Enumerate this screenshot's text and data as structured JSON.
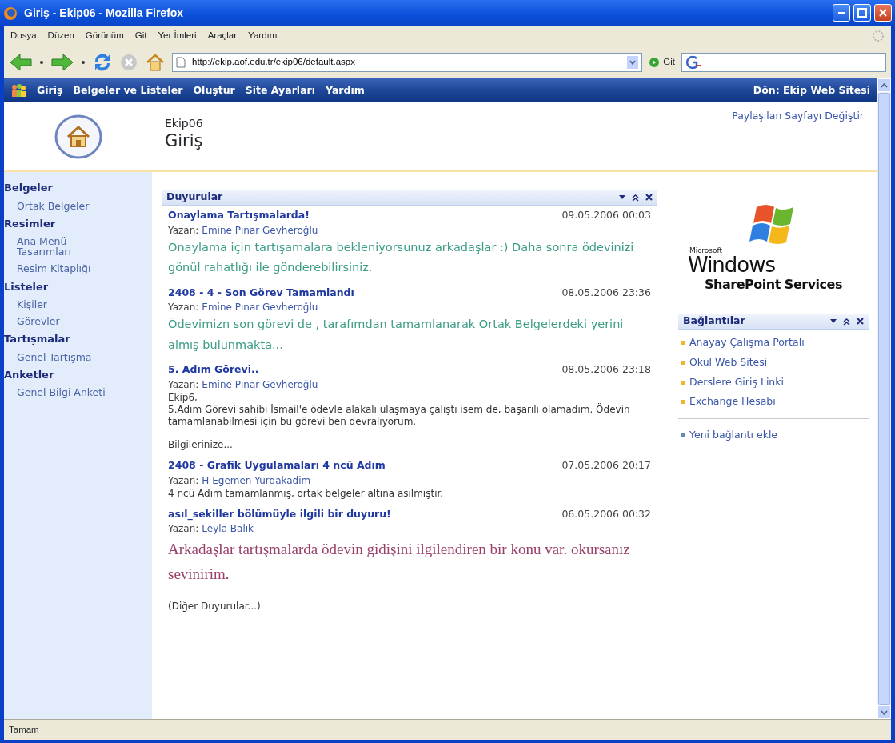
{
  "window": {
    "title": "Giriş - Ekip06  -  Mozilla Firefox"
  },
  "menu": [
    "Dosya",
    "Düzen",
    "Görünüm",
    "Git",
    "Yer İmleri",
    "Araçlar",
    "Yardım"
  ],
  "address": {
    "value": "http://ekip.aof.edu.tr/ekip06/default.aspx"
  },
  "go_button": "Git",
  "top_nav": {
    "items": [
      "Giriş",
      "Belgeler ve Listeler",
      "Oluştur",
      "Site Ayarları",
      "Yardım"
    ],
    "right_link": "Dön: Ekip Web Sitesi"
  },
  "header": {
    "site": "Ekip06",
    "page_title": "Giriş",
    "edit_link": "Paylaşılan Sayfayı Değiştir"
  },
  "sidebar": [
    {
      "label": "Belgeler",
      "children": [
        {
          "label": "Ortak Belgeler"
        }
      ]
    },
    {
      "label": "Resimler",
      "children": [
        {
          "label": "Ana Menü Tasarımları"
        },
        {
          "label": "Resim Kitaplığı"
        }
      ]
    },
    {
      "label": "Listeler",
      "children": [
        {
          "label": "Kişiler"
        },
        {
          "label": "Görevler"
        }
      ]
    },
    {
      "label": "Tartışmalar",
      "children": [
        {
          "label": "Genel Tartışma"
        }
      ]
    },
    {
      "label": "Anketler",
      "children": [
        {
          "label": "Genel Bilgi Anketi"
        }
      ]
    }
  ],
  "announcements": {
    "title": "Duyurular",
    "items": [
      {
        "title": "Onaylama Tartışmalarda!",
        "date": "09.05.2006 00:03",
        "by_label": "Yazan:",
        "author": "Emine Pınar Gevheroğlu",
        "kind": "colored",
        "color": "#3c9c86",
        "body": [
          "Onaylama için tartışamalara bekleniyorsunuz arkadaşlar :) Daha sonra ödevinizi gönül rahatlığı ile gönderebilirsiniz."
        ]
      },
      {
        "title": "2408 - 4 - Son Görev Tamamlandı",
        "date": "08.05.2006 23:36",
        "by_label": "Yazan:",
        "author": "Emine Pınar Gevheroğlu",
        "kind": "colored",
        "color": "#3c9c86",
        "body": [
          "Ödevimizn son görevi de , tarafımdan tamamlanarak Ortak Belgelerdeki yerini almış bulunmakta..."
        ]
      },
      {
        "title": "5. Adım Görevi..",
        "date": "08.05.2006 23:18",
        "by_label": "Yazan:",
        "author": "Emine Pınar Gevheroğlu",
        "kind": "plain",
        "body": [
          "Ekip6,",
          "5.Adım Görevi sahibi İsmail'e ödevle alakalı ulaşmaya çalıştı isem de, başarılı olamadım. Ödevin tamamlanabilmesi için bu görevi ben devralıyorum.",
          "Bilgilerinize..."
        ]
      },
      {
        "title": "2408 - Grafik Uygulamaları 4 ncü Adım",
        "date": "07.05.2006 20:17",
        "by_label": "Yazan:",
        "author": "H Egemen Yurdakadim",
        "kind": "plain",
        "body": [
          "4 ncü Adım tamamlanmış, ortak belgeler altına asılmıştır."
        ]
      },
      {
        "title": "asıl_sekiller bölümüyle ilgili bir duyuru!",
        "date": "06.05.2006 00:32",
        "by_label": "Yazan:",
        "author": "Leyla Balık",
        "kind": "large",
        "color": "#9a3f6a",
        "body": [
          "Arkadaşlar tartışmalarda ödevin gidişini ilgilendiren bir konu var. okursanız sevinirim."
        ]
      }
    ],
    "more_link": "(Diğer Duyurular...)"
  },
  "logo": {
    "maker": "Microsoft",
    "product": "Windows",
    "subtitle": "SharePoint Services"
  },
  "links": {
    "title": "Bağlantılar",
    "items": [
      "Anayay Çalışma Portalı",
      "Okul Web Sitesi",
      "Derslere Giriş Linki",
      "Exchange Hesabı"
    ],
    "add_link": "Yeni bağlantı ekle"
  },
  "status_bar": "Tamam"
}
